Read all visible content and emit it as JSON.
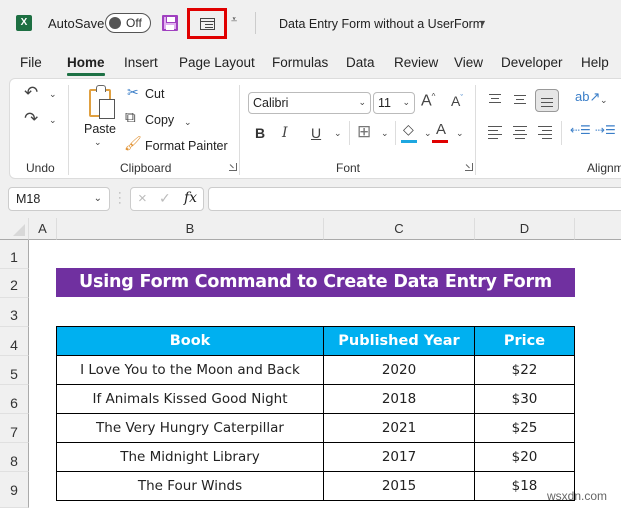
{
  "titlebar": {
    "app_icon": "excel-logo-icon",
    "autosave_label": "AutoSave",
    "autosave_state": "Off",
    "save_icon": "save-icon",
    "form_command_icon": "form-icon",
    "qat_more_icon": "customize-qat-icon",
    "document_title": "Data Entry Form without a UserForm",
    "title_dropdown_icon": "caret-down-icon",
    "highlight_color": "#e00000"
  },
  "tabs": [
    "File",
    "Home",
    "Insert",
    "Page Layout",
    "Formulas",
    "Data",
    "Review",
    "View",
    "Developer",
    "Help"
  ],
  "active_tab": "Home",
  "ribbon": {
    "undo": {
      "group_label": "Undo",
      "undo_icon": "undo-icon",
      "redo_icon": "redo-icon"
    },
    "clipboard": {
      "group_label": "Clipboard",
      "paste_label": "Paste",
      "cut_label": "Cut",
      "copy_label": "Copy",
      "format_painter_label": "Format Painter"
    },
    "font": {
      "group_label": "Font",
      "font_name": "Calibri",
      "font_size": "11",
      "bold": "B",
      "italic": "I",
      "underline": "U",
      "grow_font": "A",
      "shrink_font": "A",
      "font_color_letter": "A",
      "fill_color": "#1ea7e0",
      "font_color": "#e00000"
    },
    "alignment": {
      "group_label": "Alignm"
    }
  },
  "formula_bar": {
    "name_box": "M18",
    "cancel_icon": "×",
    "enter_icon": "✓",
    "fx_label": "fx",
    "formula_value": ""
  },
  "columns": [
    "A",
    "B",
    "C",
    "D"
  ],
  "rows": [
    "1",
    "2",
    "3",
    "4",
    "5",
    "6",
    "7",
    "8",
    "9"
  ],
  "sheet": {
    "title": "Using Form Command to Create Data Entry Form",
    "title_bg": "#7030a0",
    "header_bg": "#00b0f0",
    "table_headers": [
      "Book",
      "Published Year",
      "Price"
    ],
    "table_rows": [
      [
        "I Love You to the Moon and Back",
        "2020",
        "$22"
      ],
      [
        "If Animals Kissed Good Night",
        "2018",
        "$30"
      ],
      [
        "The Very Hungry Caterpillar",
        "2021",
        "$25"
      ],
      [
        "The Midnight Library",
        "2017",
        "$20"
      ],
      [
        "The Four Winds",
        "2015",
        "$18"
      ]
    ]
  },
  "watermark": "wsxdn.com"
}
